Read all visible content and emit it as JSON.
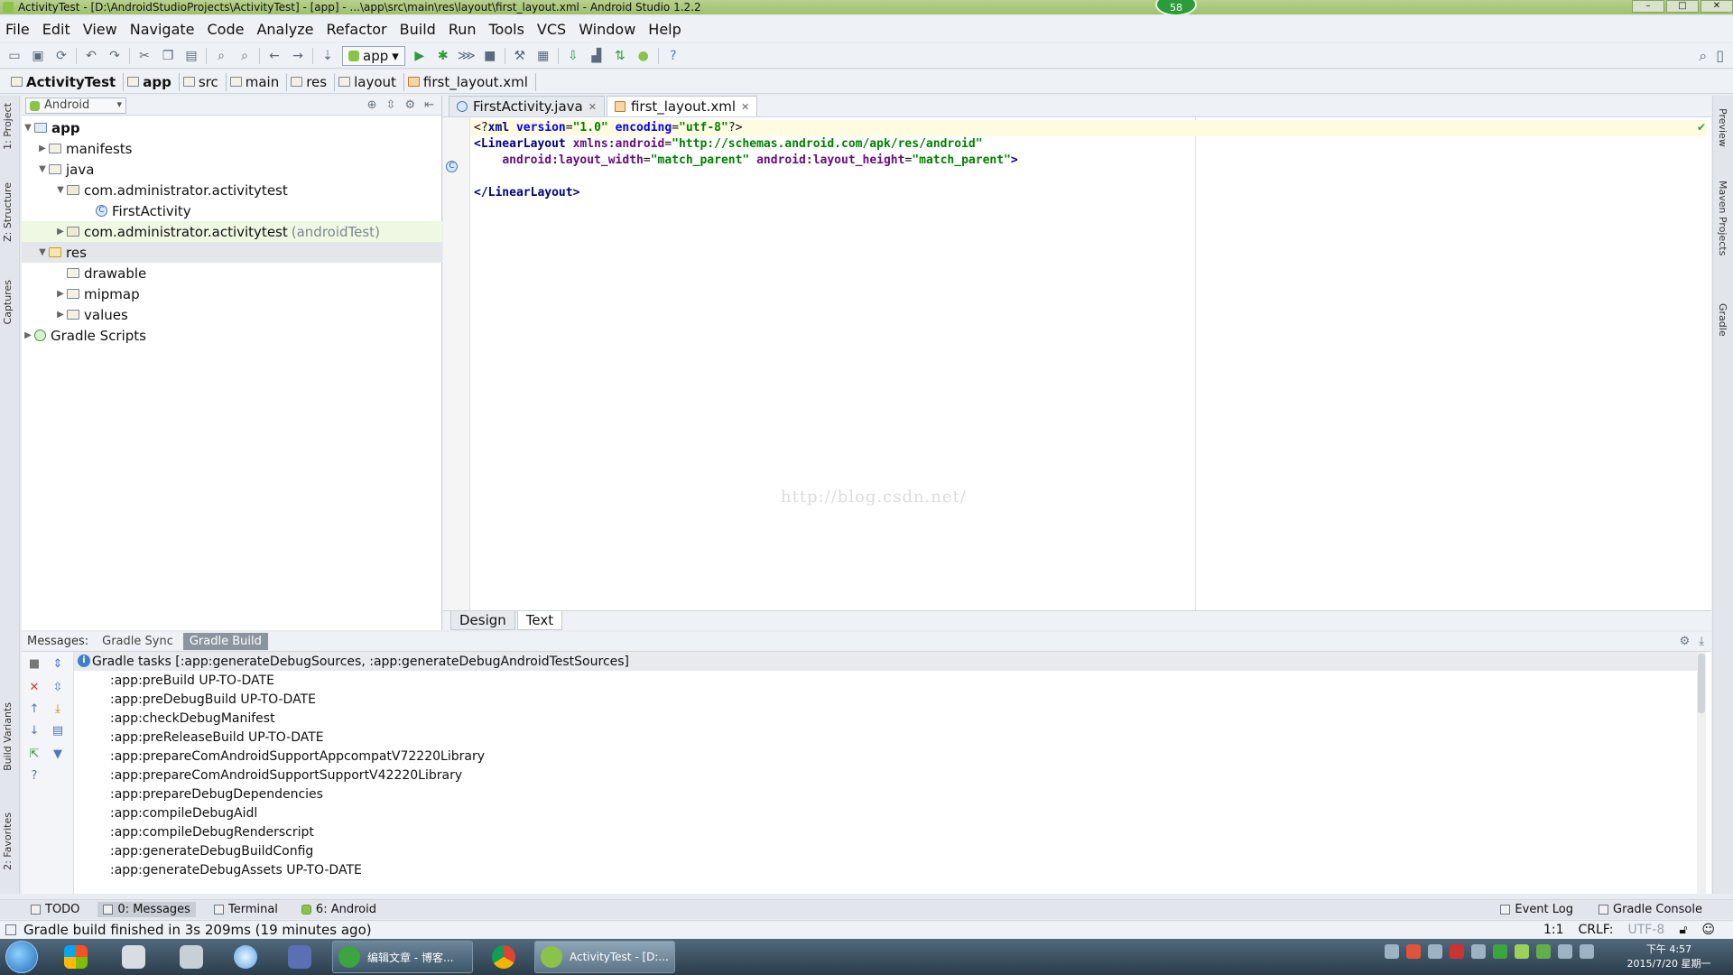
{
  "window": {
    "title": "ActivityTest - [D:\\AndroidStudioProjects\\ActivityTest] - [app] - ...\\app\\src\\main\\res\\layout\\first_layout.xml - Android Studio 1.2.2",
    "badge": "58"
  },
  "menu": [
    "File",
    "Edit",
    "View",
    "Navigate",
    "Code",
    "Analyze",
    "Refactor",
    "Build",
    "Run",
    "Tools",
    "VCS",
    "Window",
    "Help"
  ],
  "toolbar": {
    "run_config": "app"
  },
  "breadcrumb": [
    "ActivityTest",
    "app",
    "src",
    "main",
    "res",
    "layout",
    "first_layout.xml"
  ],
  "left_strip": [
    "1: Project",
    "Z: Structure",
    "Captures",
    "Build Variants",
    "2: Favorites"
  ],
  "right_strip": [
    "Preview",
    "Maven Projects",
    "Gradle"
  ],
  "project": {
    "view_selector": "Android",
    "tree": [
      {
        "label": "app",
        "extra": ""
      },
      {
        "label": "manifests",
        "extra": ""
      },
      {
        "label": "java",
        "extra": ""
      },
      {
        "label": "com.administrator.activitytest",
        "extra": ""
      },
      {
        "label": "FirstActivity",
        "extra": ""
      },
      {
        "label": "com.administrator.activitytest",
        "extra": "(androidTest)"
      },
      {
        "label": "res",
        "extra": ""
      },
      {
        "label": "drawable",
        "extra": ""
      },
      {
        "label": "mipmap",
        "extra": ""
      },
      {
        "label": "values",
        "extra": ""
      },
      {
        "label": "Gradle Scripts",
        "extra": ""
      }
    ]
  },
  "editor": {
    "tabs": [
      {
        "label": "FirstActivity.java",
        "active": false
      },
      {
        "label": "first_layout.xml",
        "active": true
      }
    ],
    "code": {
      "l1_open": "<?",
      "l1_tag": "xml",
      "l1_a1": "version",
      "l1_v1": "\"1.0\"",
      "l1_a2": "encoding",
      "l1_v2": "\"utf-8\"",
      "l1_close": "?>",
      "l2_tag": "<LinearLayout",
      "l2_ns": "xmlns:android",
      "l2_v": "\"http://schemas.android.com/apk/res/android\"",
      "l3_ns1": "android:layout_width",
      "l3_v1": "\"match_parent\"",
      "l3_ns2": "android:layout_height",
      "l3_v2": "\"match_parent\"",
      "l3_close": ">",
      "l5_tag": "</LinearLayout>"
    },
    "watermark": "http://blog.csdn.net/",
    "bottom_tabs": [
      "Design",
      "Text"
    ]
  },
  "messages": {
    "label": "Messages:",
    "tabs": [
      "Gradle Sync",
      "Gradle Build"
    ],
    "header": "Gradle tasks [:app:generateDebugSources, :app:generateDebugAndroidTestSources]",
    "lines": [
      ":app:preBuild UP-TO-DATE",
      ":app:preDebugBuild UP-TO-DATE",
      ":app:checkDebugManifest",
      ":app:preReleaseBuild UP-TO-DATE",
      ":app:prepareComAndroidSupportAppcompatV72220Library",
      ":app:prepareComAndroidSupportSupportV42220Library",
      ":app:prepareDebugDependencies",
      ":app:compileDebugAidl",
      ":app:compileDebugRenderscript",
      ":app:generateDebugBuildConfig",
      ":app:generateDebugAssets UP-TO-DATE"
    ]
  },
  "toolwindows": {
    "left": [
      {
        "label": "TODO",
        "active": false
      },
      {
        "label": "0: Messages",
        "active": true
      },
      {
        "label": "Terminal",
        "active": false
      },
      {
        "label": "6: Android",
        "active": false
      }
    ],
    "right": [
      "Event Log",
      "Gradle Console"
    ]
  },
  "status": {
    "message": "Gradle build finished in 3s 209ms (19 minutes ago)",
    "position": "1:1",
    "line_sep": "CRLF:",
    "encoding": "UTF-8"
  },
  "taskbar": {
    "buttons": [
      "编辑文章 - 博客...",
      "ActivityTest - [D:..."
    ],
    "clock_time": "下午 4:57",
    "clock_date": "2015/7/20 星期一"
  }
}
